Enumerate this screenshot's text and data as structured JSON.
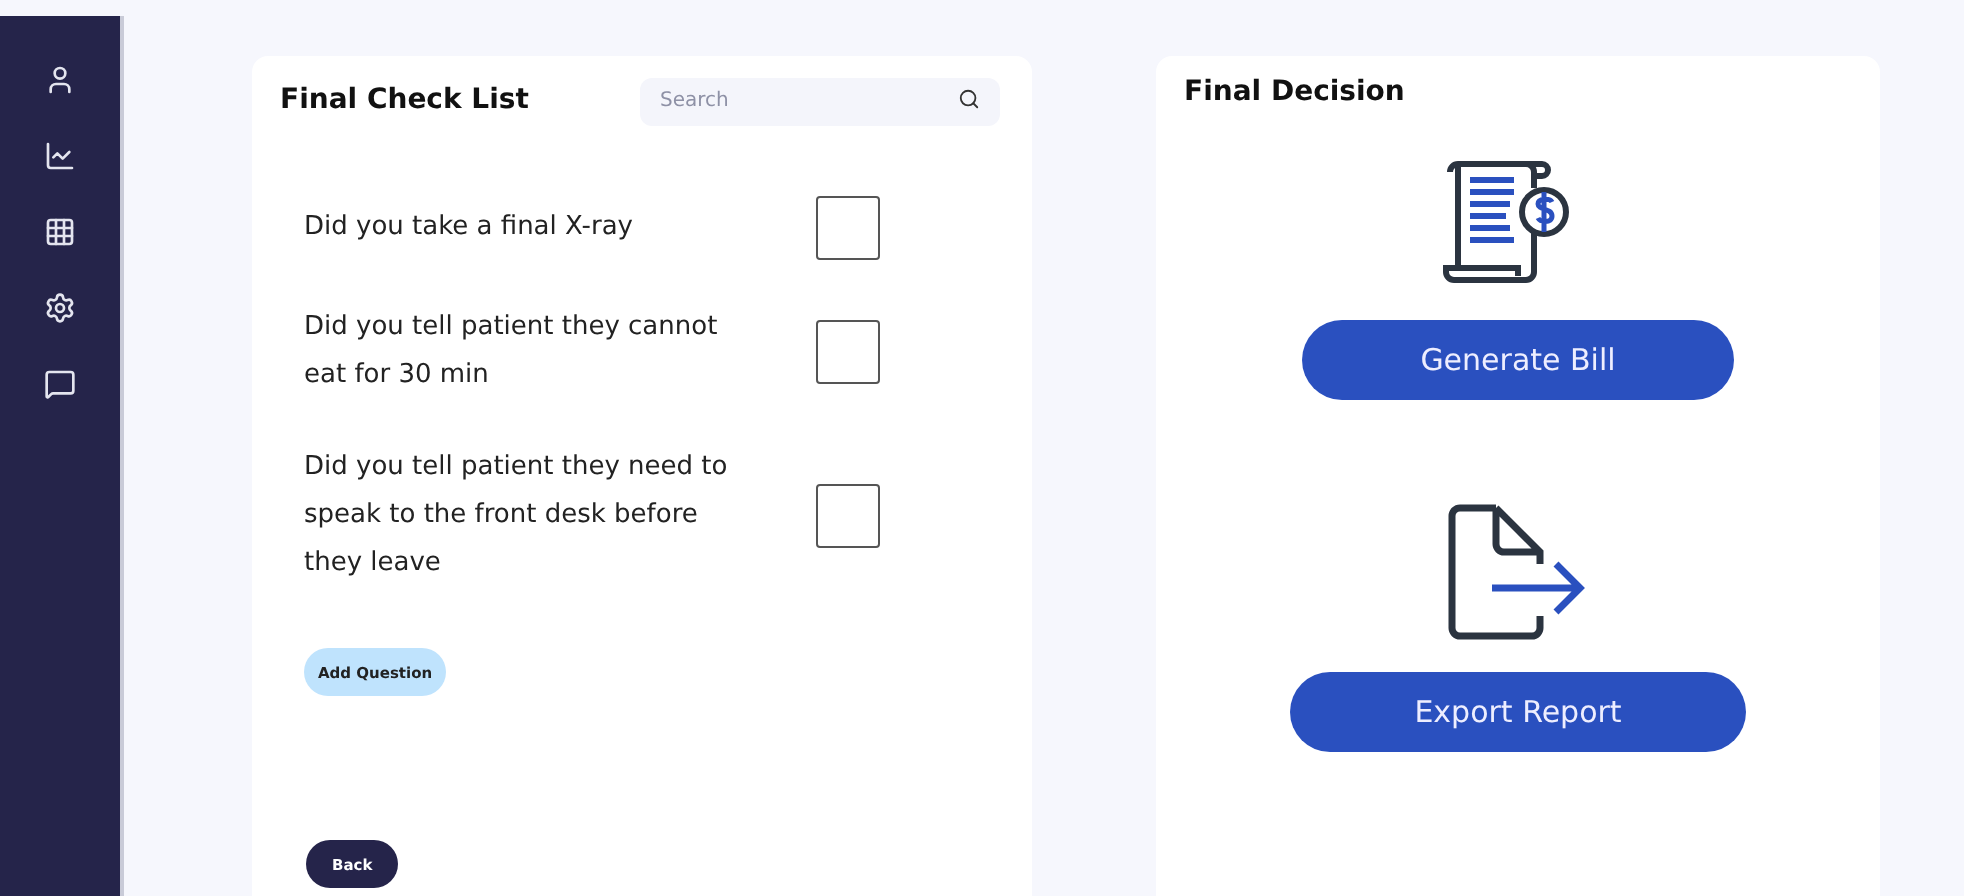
{
  "sidebar": {
    "items": [
      {
        "kind": "user"
      },
      {
        "kind": "chart"
      },
      {
        "kind": "grid"
      },
      {
        "kind": "settings"
      },
      {
        "kind": "message"
      }
    ]
  },
  "checklist": {
    "title": "Final Check List",
    "search": {
      "placeholder": "Search"
    },
    "questions": [
      {
        "text": "Did you take a final X-ray",
        "checked": false
      },
      {
        "text": "Did you tell patient they cannot eat for 30 min",
        "checked": false
      },
      {
        "text": "Did you tell patient they need to speak to the front desk before they leave",
        "checked": false
      }
    ],
    "add_button": "Add Question",
    "back_button": "Back"
  },
  "decision": {
    "title": "Final Decision",
    "actions": [
      {
        "kind": "bill",
        "label": "Generate Bill"
      },
      {
        "kind": "export",
        "label": "Export Report"
      }
    ]
  }
}
